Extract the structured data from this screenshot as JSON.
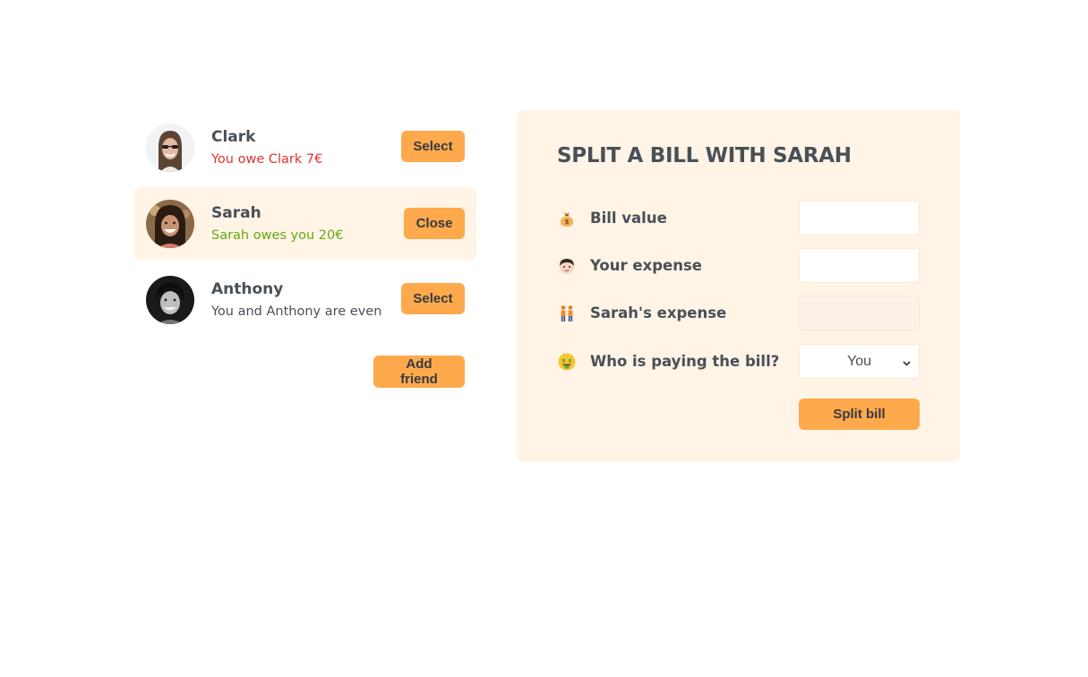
{
  "friends": [
    {
      "name": "Clark",
      "status": "You owe Clark 7€",
      "status_tone": "owe",
      "button_label": "Select",
      "selected": false
    },
    {
      "name": "Sarah",
      "status": "Sarah owes you 20€",
      "status_tone": "owed",
      "button_label": "Close",
      "selected": true
    },
    {
      "name": "Anthony",
      "status": "You and Anthony are even",
      "status_tone": "even",
      "button_label": "Select",
      "selected": false
    }
  ],
  "add_friend_label": "Add friend",
  "split_form": {
    "title": "SPLIT A BILL WITH SARAH",
    "bill_value_label": "Bill value",
    "bill_value": "",
    "your_expense_label": "Your expense",
    "your_expense": "",
    "friend_expense_label": "Sarah's expense",
    "friend_expense": "",
    "payer_label": "Who is paying the bill?",
    "payer_selected": "You",
    "submit_label": "Split bill"
  },
  "colors": {
    "accent": "#ffa94d",
    "panel_bg": "#fff4e6",
    "owe": "#e03131",
    "owed": "#66a80f",
    "text": "#495057"
  },
  "icons": [
    "money-bag-icon",
    "person-icon",
    "two-people-icon",
    "money-face-icon",
    "chevron-down-icon"
  ]
}
